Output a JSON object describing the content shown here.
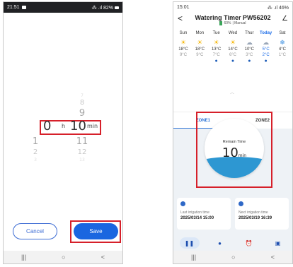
{
  "left": {
    "status": {
      "time": "21:51",
      "right": "⁂ .ıl 82%"
    },
    "picker": {
      "hours": {
        "above": [
          "",
          "",
          ""
        ],
        "selected": "0",
        "below": [
          "1",
          "2",
          "3"
        ],
        "label": "h"
      },
      "minutes": {
        "above": [
          "7",
          "8",
          "9"
        ],
        "selected": "10",
        "below": [
          "11",
          "12",
          "13"
        ],
        "label": "min"
      }
    },
    "buttons": {
      "cancel": "Cancel",
      "save": "Save"
    },
    "nav": {
      "recent": "|||",
      "home": "○",
      "back": "<"
    }
  },
  "right": {
    "status": {
      "time": "15:01",
      "right": "⁂ .ıl 46%"
    },
    "header": {
      "back": "<",
      "title": "Watering Timer PW56202",
      "battery": "60%",
      "mode": "| Manual",
      "edit": "∠"
    },
    "weather": [
      {
        "day": "Sun",
        "icon": "sun",
        "hi": "18°C",
        "lo": "9°C",
        "rain": false,
        "today": false
      },
      {
        "day": "Mon",
        "icon": "sun",
        "hi": "18°C",
        "lo": "9°C",
        "rain": false,
        "today": false
      },
      {
        "day": "Tue",
        "icon": "sun",
        "hi": "13°C",
        "lo": "7°C",
        "rain": true,
        "today": false
      },
      {
        "day": "Wed",
        "icon": "sun",
        "hi": "14°C",
        "lo": "6°C",
        "rain": true,
        "today": false
      },
      {
        "day": "Thur",
        "icon": "cloud-rain",
        "hi": "10°C",
        "lo": "3°C",
        "rain": true,
        "today": false
      },
      {
        "day": "Today",
        "icon": "cloud-rain",
        "hi": "5°C",
        "lo": "2°C",
        "rain": true,
        "today": true
      },
      {
        "day": "Sat",
        "icon": "snow",
        "hi": "4°C",
        "lo": "1°C",
        "rain": false,
        "today": false
      }
    ],
    "zones": {
      "zone1": "ZONE1",
      "zone2": "ZONE2"
    },
    "remain": {
      "label": "Remain Time",
      "value": "10",
      "unit": "min"
    },
    "cards": {
      "last": {
        "label": "Last irrigation time",
        "value": "2025/03/14 15:00"
      },
      "next": {
        "label": "Next irrigation time",
        "value": "2025/03/19 16:39"
      }
    },
    "nav": {
      "recent": "|||",
      "home": "○",
      "back": "<"
    }
  }
}
